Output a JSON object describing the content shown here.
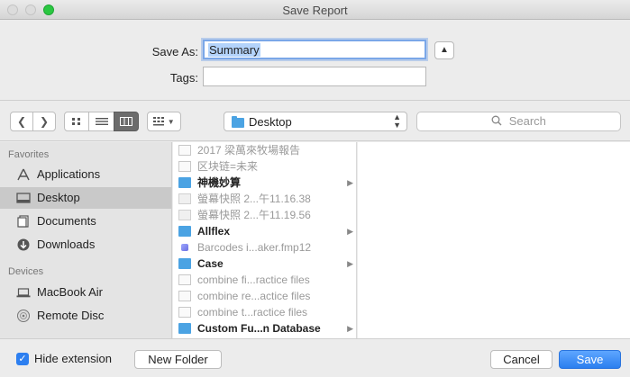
{
  "window": {
    "title": "Save Report"
  },
  "save": {
    "save_as_label": "Save As:",
    "save_as_value": "Summary",
    "tags_label": "Tags:",
    "tags_value": "",
    "collapse_icon": "chevron-up-icon"
  },
  "toolbar": {
    "back_icon": "chevron-left-icon",
    "forward_icon": "chevron-right-icon",
    "view_modes": [
      "icon-view",
      "list-view",
      "column-view"
    ],
    "active_view": "column-view",
    "arrange_icon": "arrange-grid-icon",
    "location": "Desktop",
    "search_placeholder": "Search"
  },
  "sidebar": {
    "favorites_label": "Favorites",
    "favorites": [
      {
        "label": "Applications",
        "icon": "applications-icon",
        "selected": false
      },
      {
        "label": "Desktop",
        "icon": "desktop-icon",
        "selected": true
      },
      {
        "label": "Documents",
        "icon": "documents-icon",
        "selected": false
      },
      {
        "label": "Downloads",
        "icon": "downloads-icon",
        "selected": false
      }
    ],
    "devices_label": "Devices",
    "devices": [
      {
        "label": "MacBook Air",
        "icon": "laptop-icon"
      },
      {
        "label": "Remote Disc",
        "icon": "disc-icon"
      }
    ]
  },
  "files": [
    {
      "name": "2017 梁萬來牧場報告",
      "kind": "doc",
      "dim": true,
      "folder": false
    },
    {
      "name": "区块链=未来",
      "kind": "doc",
      "dim": true,
      "folder": false
    },
    {
      "name": "神機妙算",
      "kind": "folder",
      "dim": false,
      "folder": true
    },
    {
      "name": "螢幕快照 2...午11.16.38",
      "kind": "img",
      "dim": true,
      "folder": false
    },
    {
      "name": "螢幕快照 2...午11.19.56",
      "kind": "img",
      "dim": true,
      "folder": false
    },
    {
      "name": "Allflex",
      "kind": "folder",
      "dim": false,
      "folder": true
    },
    {
      "name": "Barcodes i...aker.fmp12",
      "kind": "fmp",
      "dim": true,
      "folder": false
    },
    {
      "name": "Case",
      "kind": "folder",
      "dim": false,
      "folder": true
    },
    {
      "name": "combine fi...ractice files",
      "kind": "doc",
      "dim": true,
      "folder": false
    },
    {
      "name": "combine re...actice files",
      "kind": "doc",
      "dim": true,
      "folder": false
    },
    {
      "name": "combine t...ractice files",
      "kind": "doc",
      "dim": true,
      "folder": false
    },
    {
      "name": "Custom Fu...n Database",
      "kind": "folder",
      "dim": false,
      "folder": true
    }
  ],
  "bottom": {
    "hide_extension_label": "Hide extension",
    "hide_extension_checked": true,
    "new_folder_label": "New Folder",
    "cancel_label": "Cancel",
    "save_label": "Save"
  },
  "colors": {
    "accent": "#2b7fef",
    "folder": "#4ba3e3",
    "selection": "#b3d3fb"
  }
}
